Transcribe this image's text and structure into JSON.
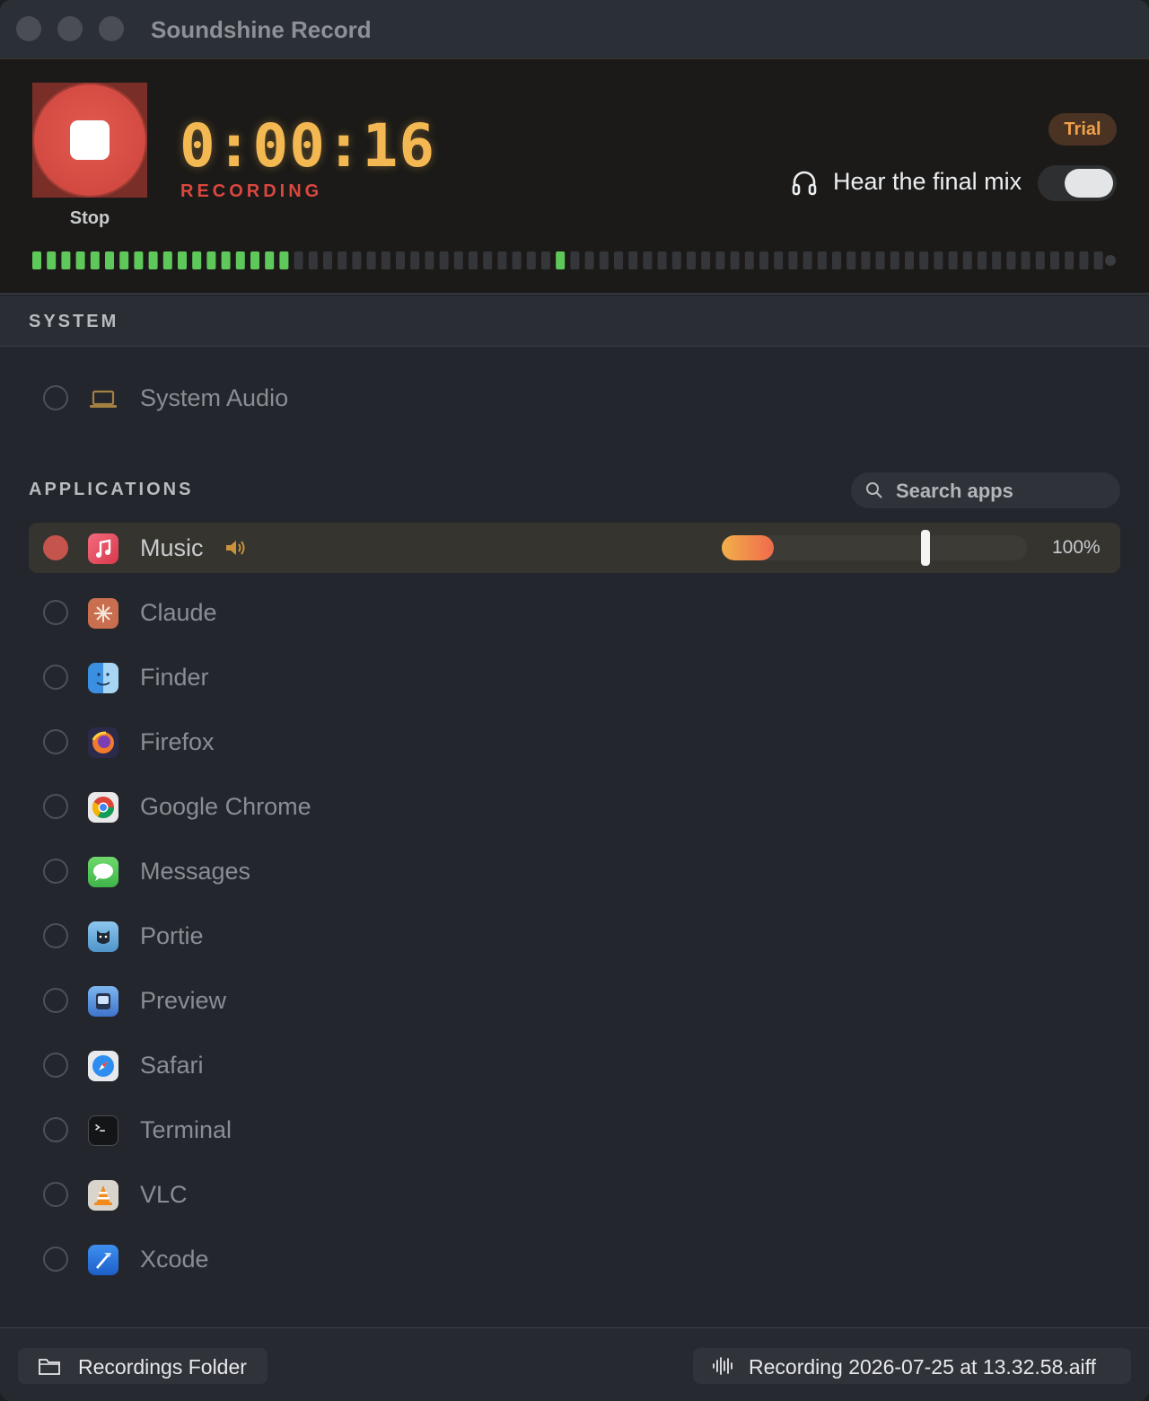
{
  "window": {
    "title": "Soundshine Record"
  },
  "recorder": {
    "stop_label": "Stop",
    "elapsed": "0:00:16",
    "status": "RECORDING",
    "badge": "Trial",
    "monitor_label": "Hear the final mix",
    "monitor_enabled": true,
    "level_meter": {
      "lit_segments": 18,
      "peak_segment": 36,
      "total_segments": 74
    }
  },
  "system": {
    "heading": "SYSTEM",
    "items": [
      {
        "label": "System Audio",
        "icon": "laptop-icon",
        "selected": false
      }
    ]
  },
  "applications": {
    "heading": "APPLICATIONS",
    "search_placeholder": "Search apps",
    "items": [
      {
        "label": "Music",
        "icon": "music-icon",
        "selected": true,
        "volume_label": "100%",
        "volume": 1.0,
        "level": 0.17
      },
      {
        "label": "Claude",
        "icon": "claude-icon",
        "selected": false
      },
      {
        "label": "Finder",
        "icon": "finder-icon",
        "selected": false
      },
      {
        "label": "Firefox",
        "icon": "firefox-icon",
        "selected": false
      },
      {
        "label": "Google Chrome",
        "icon": "chrome-icon",
        "selected": false
      },
      {
        "label": "Messages",
        "icon": "messages-icon",
        "selected": false
      },
      {
        "label": "Portie",
        "icon": "portie-icon",
        "selected": false
      },
      {
        "label": "Preview",
        "icon": "preview-icon",
        "selected": false
      },
      {
        "label": "Safari",
        "icon": "safari-icon",
        "selected": false
      },
      {
        "label": "Terminal",
        "icon": "terminal-icon",
        "selected": false
      },
      {
        "label": "VLC",
        "icon": "vlc-icon",
        "selected": false
      },
      {
        "label": "Xcode",
        "icon": "xcode-icon",
        "selected": false
      }
    ]
  },
  "footer": {
    "folder_label": "Recordings Folder",
    "file_label": "Recording 2026-07-25 at 13.32.58.aiff"
  },
  "colors": {
    "accent": "#f3b852",
    "recording": "#d9483e",
    "meter_on": "#5fc85a",
    "meter_off": "#34363a"
  }
}
